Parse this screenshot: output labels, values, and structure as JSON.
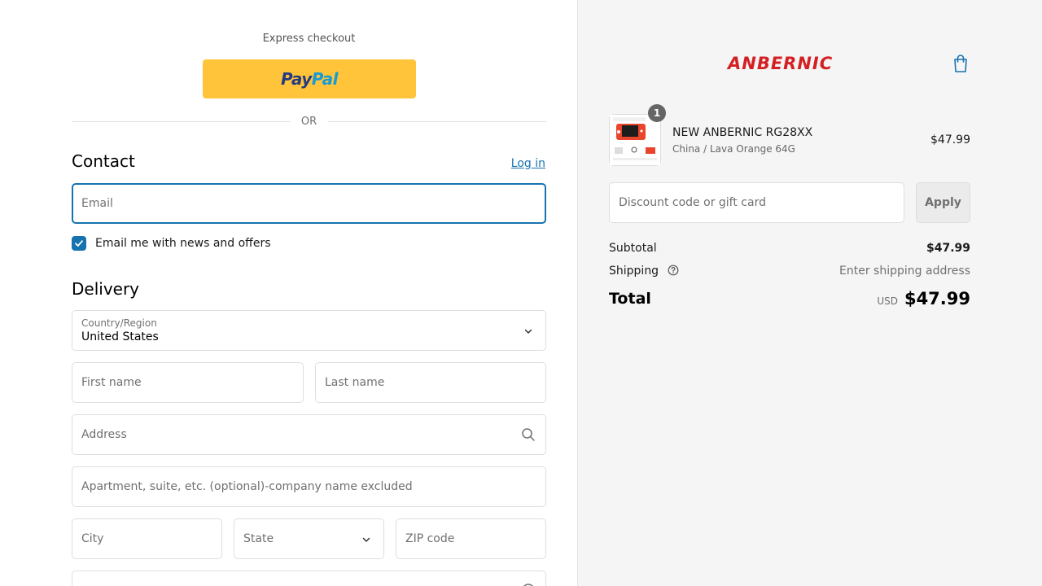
{
  "express": {
    "label": "Express checkout",
    "paypal_pay": "Pay",
    "paypal_pal": "Pal",
    "or_text": "OR"
  },
  "contact": {
    "title": "Contact",
    "login_link": "Log in",
    "email_placeholder": "Email",
    "newsletter_label": "Email me with news and offers",
    "newsletter_checked": true
  },
  "delivery": {
    "title": "Delivery",
    "country_label": "Country/Region",
    "country_value": "United States",
    "first_name_placeholder": "First name",
    "last_name_placeholder": "Last name",
    "address_placeholder": "Address",
    "apartment_placeholder": "Apartment, suite, etc. (optional)-company name excluded",
    "city_placeholder": "City",
    "state_placeholder": "State",
    "zip_placeholder": "ZIP code"
  },
  "brand": {
    "name": "ANBERNIC",
    "color": "#d41f23"
  },
  "cart": {
    "item": {
      "quantity": "1",
      "name": "NEW ANBERNIC RG28XX",
      "variant": "China / Lava Orange 64G",
      "price": "$47.99"
    },
    "discount_placeholder": "Discount code or gift card",
    "apply_label": "Apply",
    "subtotal_label": "Subtotal",
    "subtotal_value": "$47.99",
    "shipping_label": "Shipping",
    "shipping_value": "Enter shipping address",
    "total_label": "Total",
    "total_currency": "USD",
    "total_value": "$47.99"
  },
  "colors": {
    "accent": "#1773b0",
    "paypal_yellow": "#ffc439"
  },
  "icons": [
    "paypal-logo",
    "check-icon",
    "chevron-down-icon",
    "search-icon",
    "shopping-bag-icon",
    "help-circle-icon"
  ]
}
